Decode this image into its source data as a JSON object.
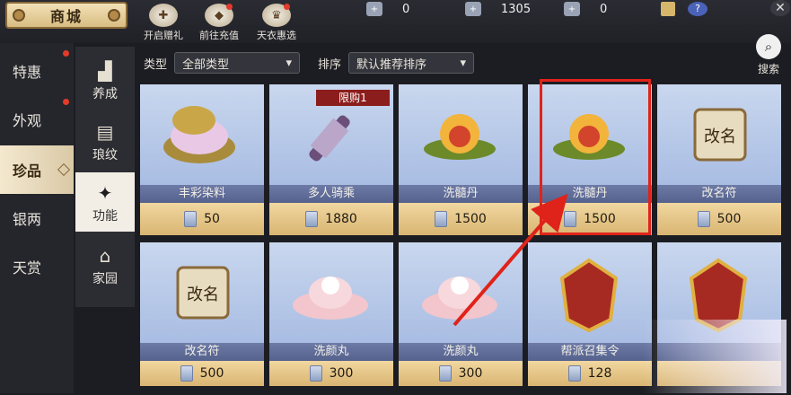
{
  "header": {
    "title": "商城",
    "shortcuts": [
      {
        "label": "开启赠礼",
        "icon": "gift-icon"
      },
      {
        "label": "前往充值",
        "icon": "recharge-icon"
      },
      {
        "label": "天衣惠选",
        "icon": "dress-icon"
      }
    ],
    "currencies": [
      {
        "icon": "silver-coin-icon",
        "value": "0"
      },
      {
        "icon": "gold-ingot-icon",
        "value": "1305"
      },
      {
        "icon": "token-icon",
        "value": "0"
      }
    ]
  },
  "categories": [
    {
      "label": "特惠",
      "badge": true,
      "selected": false
    },
    {
      "label": "外观",
      "badge": true,
      "selected": false
    },
    {
      "label": "珍品",
      "badge": false,
      "selected": true
    },
    {
      "label": "银两",
      "badge": false,
      "selected": false
    },
    {
      "label": "天赏",
      "badge": false,
      "selected": false
    }
  ],
  "subcategories": [
    {
      "label": "养成",
      "icon": "boot-icon",
      "selected": false
    },
    {
      "label": "琅纹",
      "icon": "chest-icon",
      "selected": false
    },
    {
      "label": "功能",
      "icon": "shuriken-icon",
      "selected": true
    },
    {
      "label": "家园",
      "icon": "house-icon",
      "selected": false
    }
  ],
  "filters": {
    "type_label": "类型",
    "type_value": "全部类型",
    "sort_label": "排序",
    "sort_value": "默认推荐排序"
  },
  "search": {
    "label": "搜索"
  },
  "items": [
    {
      "name": "丰彩染料",
      "price": "50",
      "icon": "dye-bowl-icon"
    },
    {
      "name": "多人骑乘",
      "price": "1880",
      "icon": "scroll-icon",
      "tag": "限购1"
    },
    {
      "name": "洗髓丹",
      "price": "1500",
      "icon": "pill-lotus-icon"
    },
    {
      "name": "洗髓丹",
      "price": "1500",
      "icon": "pill-lotus-icon"
    },
    {
      "name": "改名符",
      "price": "500",
      "icon": "rename-scroll-icon"
    },
    {
      "name": "改名符",
      "price": "500",
      "icon": "rename-scroll-icon"
    },
    {
      "name": "洗颜丸",
      "price": "300",
      "icon": "lotus-pearl-icon"
    },
    {
      "name": "洗颜丸",
      "price": "300",
      "icon": "lotus-pearl-icon"
    },
    {
      "name": "帮派召集令",
      "price": "128",
      "icon": "guild-token-icon"
    },
    {
      "name": "",
      "price": "",
      "icon": "guild-token-icon"
    }
  ],
  "colors": {
    "highlight": "#e0231a",
    "accent_gold": "#d9b572",
    "panel_dark": "#1c1d22"
  }
}
